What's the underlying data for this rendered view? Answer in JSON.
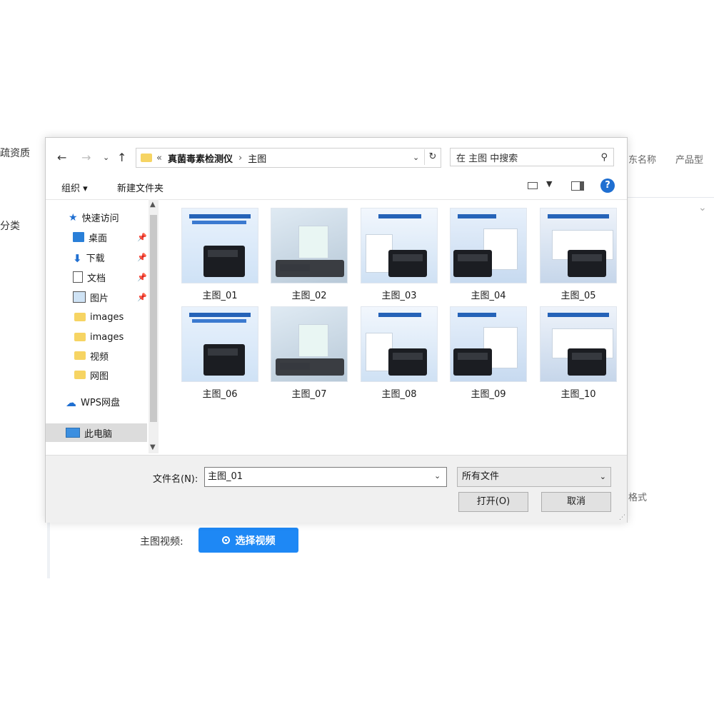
{
  "background": {
    "left_labels": [
      "疏资质",
      "分类"
    ],
    "right_texts": [
      "东名称",
      "产品型",
      "格式"
    ],
    "video_label": "主图视频:",
    "video_button": "选择视频"
  },
  "dialog": {
    "breadcrumb": [
      "«",
      "真菌毒素检测仪",
      "›",
      "主图"
    ],
    "search_placeholder": "在 主图 中搜索",
    "toolbar": {
      "organize": "组织 ▾",
      "new_folder": "新建文件夹"
    },
    "nav": [
      {
        "label": "快速访问",
        "icon": "star-icon"
      },
      {
        "label": "桌面",
        "icon": "desktop-icon",
        "pinned": true
      },
      {
        "label": "下载",
        "icon": "download-icon",
        "pinned": true
      },
      {
        "label": "文档",
        "icon": "document-icon",
        "pinned": true
      },
      {
        "label": "图片",
        "icon": "pictures-icon",
        "pinned": true
      },
      {
        "label": "images",
        "icon": "folder-icon"
      },
      {
        "label": "images",
        "icon": "folder-icon"
      },
      {
        "label": "视频",
        "icon": "folder-icon"
      },
      {
        "label": "网图",
        "icon": "folder-icon"
      },
      {
        "label": "WPS网盘",
        "icon": "cloud-icon"
      },
      {
        "label": "此电脑",
        "icon": "computer-icon",
        "selected": true
      }
    ],
    "files": [
      "主图_01",
      "主图_02",
      "主图_03",
      "主图_04",
      "主图_05",
      "主图_06",
      "主图_07",
      "主图_08",
      "主图_09",
      "主图_10"
    ],
    "filename_label": "文件名(N):",
    "filename_value": "主图_01",
    "file_type": "所有文件",
    "open_button": "打开(O)",
    "cancel_button": "取消"
  },
  "colors": {
    "accent": "#1e88f5",
    "folder": "#f6d463",
    "help": "#1f6fd1"
  }
}
